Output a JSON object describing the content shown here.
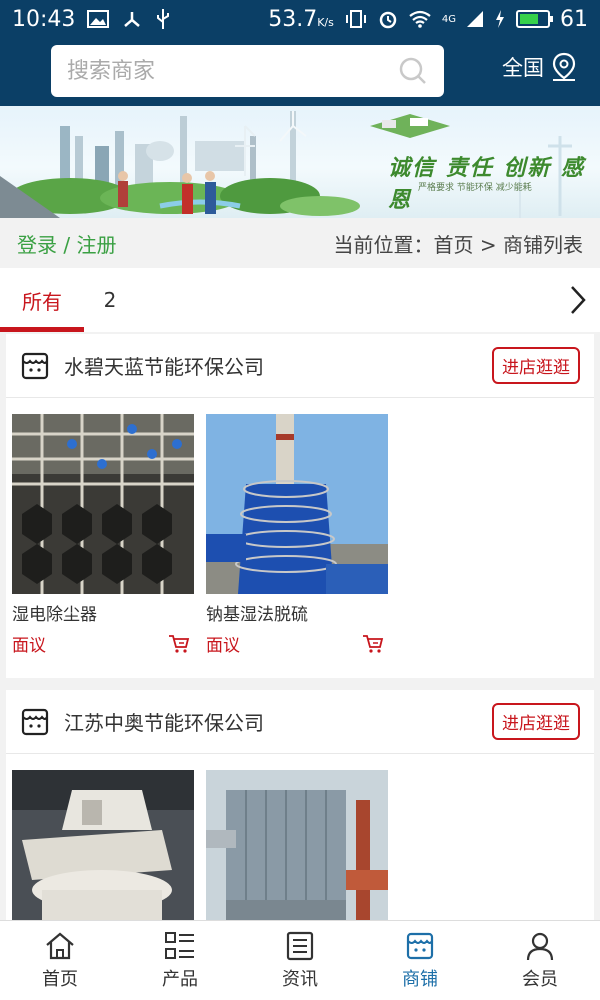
{
  "status_bar": {
    "time": "10:43",
    "speed": "53.7",
    "speed_unit": "K/s",
    "network": "4G",
    "battery": "61",
    "battery_level": 0.61
  },
  "header": {
    "search_placeholder": "搜索商家",
    "region_label": "全国"
  },
  "banner": {
    "slogan": "诚信 责任 创新 感恩",
    "subtitle": "严格要求 节能环保 减少能耗"
  },
  "location": {
    "login_link": "登录 / 注册",
    "breadcrumb": "当前位置：首页 > 商铺列表"
  },
  "tabs": [
    {
      "label": "所有"
    },
    {
      "label": "2"
    }
  ],
  "shops": [
    {
      "name": "水碧天蓝节能环保公司",
      "visit_label": "进店逛逛",
      "products": [
        {
          "name": "湿电除尘器",
          "price": "面议"
        },
        {
          "name": "钠基湿法脱硫",
          "price": "面议"
        }
      ]
    },
    {
      "name": "江苏中奥节能环保公司",
      "visit_label": "进店逛逛",
      "products": [
        {
          "name": "",
          "price": ""
        },
        {
          "name": "",
          "price": ""
        }
      ]
    }
  ],
  "bottom_nav": [
    {
      "label": "首页",
      "icon": "home-icon"
    },
    {
      "label": "产品",
      "icon": "list-icon"
    },
    {
      "label": "资讯",
      "icon": "news-icon"
    },
    {
      "label": "商铺",
      "icon": "shop-icon"
    },
    {
      "label": "会员",
      "icon": "user-icon"
    }
  ],
  "colors": {
    "header_bg": "#0b3f66",
    "accent_red": "#c8161d",
    "login_green": "#3aa043",
    "nav_active": "#1d6fa8"
  }
}
